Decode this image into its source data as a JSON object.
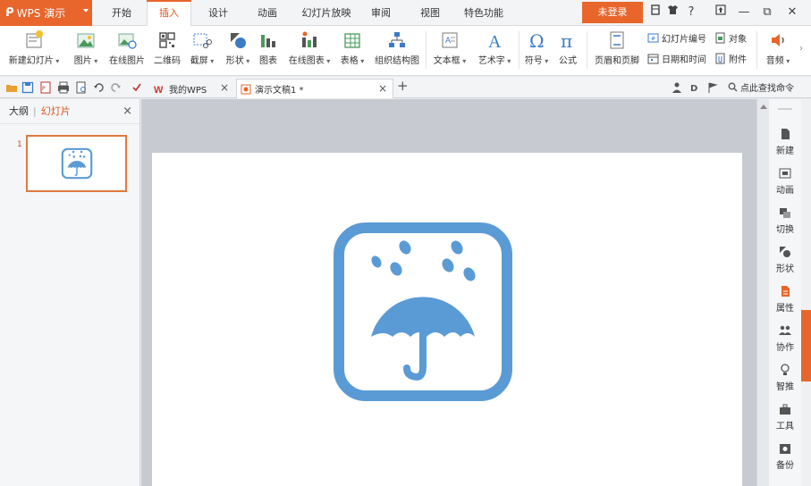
{
  "app": {
    "name": "WPS 演示",
    "logo": "ᑭ"
  },
  "tabs": [
    {
      "label": "开始",
      "active": false
    },
    {
      "label": "插入",
      "active": true
    },
    {
      "label": "设计",
      "active": false
    },
    {
      "label": "动画",
      "active": false
    },
    {
      "label": "幻灯片放映",
      "active": false
    },
    {
      "label": "审阅",
      "active": false
    },
    {
      "label": "视图",
      "active": false
    },
    {
      "label": "特色功能",
      "active": false
    }
  ],
  "login_label": "未登录",
  "window_controls": {
    "help": "?",
    "minimize": "—",
    "restore": "⧉",
    "close": "✕"
  },
  "ribbon": {
    "new_slide": "新建幻灯片",
    "picture": "图片",
    "online_picture": "在线图片",
    "qrcode": "二维码",
    "screenshot": "截屏",
    "shape": "形状",
    "chart": "图表",
    "online_chart": "在线图表",
    "table": "表格",
    "smartart": "组织结构图",
    "textbox": "文本框",
    "wordart": "艺术字",
    "symbol": "符号",
    "formula": "公式",
    "header_footer": "页眉和页脚",
    "slide_number": "幻灯片编号",
    "object": "对象",
    "datetime": "日期和时间",
    "attachment": "附件",
    "audio": "音频"
  },
  "doc_tabs": [
    {
      "label": "我的WPS",
      "active": false
    },
    {
      "label": "演示文稿1 *",
      "active": true
    }
  ],
  "search_label": "点此查找命令",
  "left_panel": {
    "tab_outline": "大纲",
    "tab_slides": "幻灯片",
    "slide_number": "1"
  },
  "side_tools": [
    {
      "label": "新建"
    },
    {
      "label": "动画"
    },
    {
      "label": "切换"
    },
    {
      "label": "形状"
    },
    {
      "label": "属性"
    },
    {
      "label": "协作"
    },
    {
      "label": "智推"
    },
    {
      "label": "工具"
    },
    {
      "label": "备份"
    }
  ],
  "colors": {
    "brand": "#e8652b",
    "icon_blue": "#5b9bd5",
    "active_tab_text": "#e0521c"
  }
}
